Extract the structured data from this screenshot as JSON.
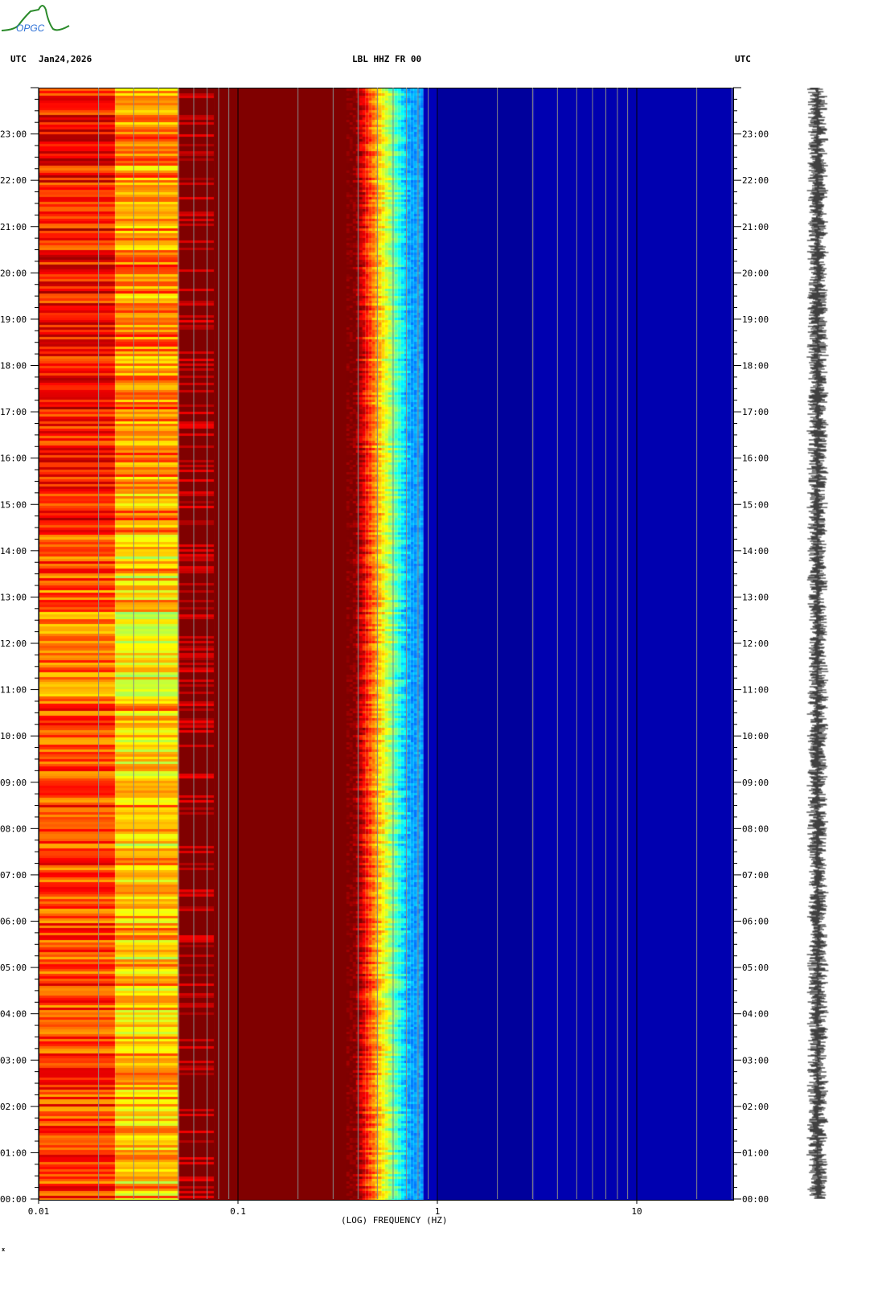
{
  "header": {
    "left_tz": "UTC",
    "date": "Jan24,2026",
    "station": "LBL HHZ FR 00",
    "right_tz": "UTC",
    "logo_text": "OPGC"
  },
  "chart_data": {
    "type": "heatmap",
    "title": "LBL HHZ FR 00",
    "xlabel": "(LOG) FREQUENCY (HZ)",
    "xscale": "log",
    "xlim": [
      0.01,
      30
    ],
    "x_ticks": [
      "0.01",
      "0.1",
      "1",
      "10"
    ],
    "ylim_hours": [
      0,
      24
    ],
    "y_ticks": [
      "00:00",
      "01:00",
      "02:00",
      "03:00",
      "04:00",
      "05:00",
      "06:00",
      "07:00",
      "08:00",
      "09:00",
      "10:00",
      "11:00",
      "12:00",
      "13:00",
      "14:00",
      "15:00",
      "16:00",
      "17:00",
      "18:00",
      "19:00",
      "20:00",
      "21:00",
      "22:00",
      "23:00"
    ],
    "colormap": "jet",
    "bands_hz": [
      {
        "from": 0.01,
        "to": 0.024,
        "level": "yellow-orange"
      },
      {
        "from": 0.024,
        "to": 0.05,
        "level": "red-orange"
      },
      {
        "from": 0.05,
        "to": 0.075,
        "level": "dark red with red streaks"
      },
      {
        "from": 0.075,
        "to": 0.38,
        "level": "dark red"
      },
      {
        "from": 0.38,
        "to": 0.7,
        "level": "red to cyan transition"
      },
      {
        "from": 0.7,
        "to": 30,
        "level": "blue"
      }
    ]
  },
  "footer_mark": "x"
}
